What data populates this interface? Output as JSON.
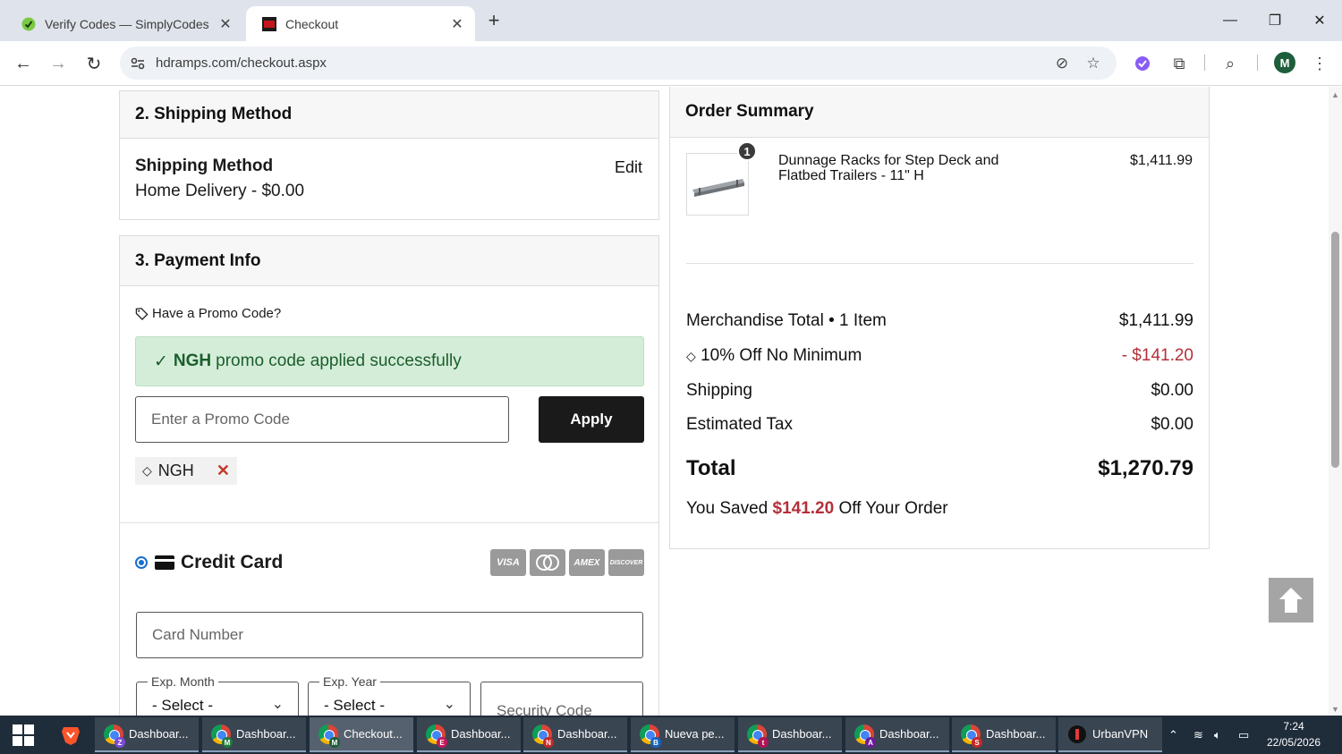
{
  "browser": {
    "tabs": [
      {
        "title": "Verify Codes — SimplyCodes",
        "active": false,
        "icon": "simplycodes-favicon"
      },
      {
        "title": "Checkout",
        "active": true,
        "icon": "hdramps-favicon"
      }
    ],
    "url": "hdramps.com/checkout.aspx",
    "profile_initial": "M"
  },
  "shipping": {
    "heading": "2. Shipping Method",
    "label": "Shipping Method",
    "value": "Home Delivery - $0.00",
    "edit": "Edit"
  },
  "payment": {
    "heading": "3. Payment Info",
    "promo_question": "Have a Promo Code?",
    "promo_success_code": "NGH",
    "promo_success_text": "promo code applied successfully",
    "promo_placeholder": "Enter a Promo Code",
    "apply_label": "Apply",
    "applied_code": "NGH",
    "credit_card_label": "Credit Card",
    "card_logos": [
      "VISA",
      "MC",
      "AMEX",
      "DISCOVER"
    ],
    "card_number_placeholder": "Card Number",
    "exp_month_label": "Exp. Month",
    "exp_month_value": "- Select -",
    "exp_year_label": "Exp. Year",
    "exp_year_value": "- Select -",
    "security_placeholder": "Security Code"
  },
  "summary": {
    "heading": "Order Summary",
    "item": {
      "qty": "1",
      "name": "Dunnage Racks for Step Deck and Flatbed Trailers - 11\" H",
      "price": "$1,411.99"
    },
    "rows": [
      {
        "label": "Merchandise Total • 1 Item",
        "value": "$1,411.99",
        "discount": false
      },
      {
        "label": "10% Off No Minimum",
        "value": "- $141.20",
        "discount": true
      },
      {
        "label": "Shipping",
        "value": "$0.00",
        "discount": false
      },
      {
        "label": "Estimated Tax",
        "value": "$0.00",
        "discount": false
      }
    ],
    "total_label": "Total",
    "total_value": "$1,270.79",
    "saved_prefix": "You Saved",
    "saved_amount": "$141.20",
    "saved_suffix": "Off Your Order"
  },
  "taskbar": {
    "apps": [
      {
        "label": "Dashboar...",
        "badge": "Z",
        "badge_color": "#7b4bd6"
      },
      {
        "label": "Dashboar...",
        "badge": "M",
        "badge_color": "#1e7a3c"
      },
      {
        "label": "Checkout...",
        "badge": "M",
        "badge_color": "#1e5e3a",
        "current": true
      },
      {
        "label": "Dashboar...",
        "badge": "E",
        "badge_color": "#c2185b"
      },
      {
        "label": "Dashboar...",
        "badge": "N",
        "badge_color": "#c62828"
      },
      {
        "label": "Nueva pe...",
        "badge": "B",
        "badge_color": "#1565c0"
      },
      {
        "label": "Dashboar...",
        "badge": "t",
        "badge_color": "#ad1457"
      },
      {
        "label": "Dashboar...",
        "badge": "A",
        "badge_color": "#6a1b9a"
      },
      {
        "label": "Dashboar...",
        "badge": "S",
        "badge_color": "#c62828"
      },
      {
        "label": "UrbanVPN",
        "badge": "",
        "badge_color": ""
      }
    ],
    "time": "7:24",
    "date": "22/05/2026"
  }
}
